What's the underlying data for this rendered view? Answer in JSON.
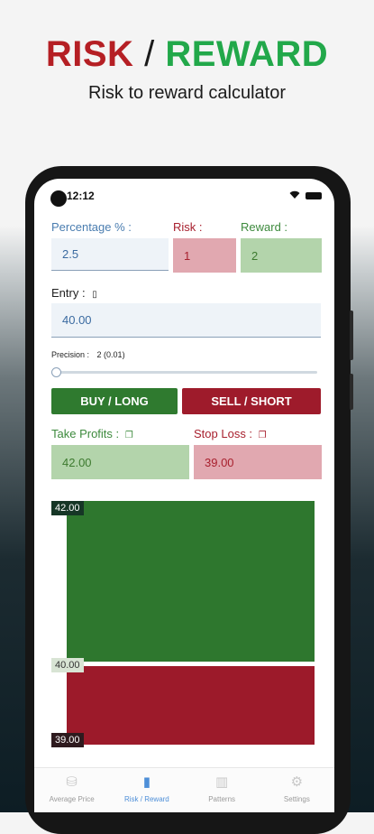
{
  "promo": {
    "title_left": "RISK",
    "title_sep": "/",
    "title_right": "REWARD",
    "subtitle": "Risk to reward calculator"
  },
  "status_bar": {
    "time": "12:12"
  },
  "form": {
    "percentage_label": "Percentage % :",
    "percentage_value": "2.5",
    "risk_label": "Risk :",
    "risk_value": "1",
    "reward_label": "Reward :",
    "reward_value": "2",
    "entry_label": "Entry :",
    "entry_value": "40.00",
    "precision_label": "Precision :",
    "precision_value": "2 (0.01)",
    "precision_slider_level": 0,
    "buy_label": "BUY / LONG",
    "sell_label": "SELL / SHORT",
    "take_profits_label": "Take Profits :",
    "take_profits_value": "42.00",
    "stop_loss_label": "Stop Loss :",
    "stop_loss_value": "39.00"
  },
  "visual": {
    "take_profit_tag": "42.00",
    "entry_tag": "40.00",
    "stop_loss_tag": "39.00"
  },
  "nav": [
    {
      "label": "Average Price",
      "icon": "coins-icon",
      "active": false
    },
    {
      "label": "Risk / Reward",
      "icon": "risk-reward-icon",
      "active": true
    },
    {
      "label": "Patterns",
      "icon": "candles-icon",
      "active": false
    },
    {
      "label": "Settings",
      "icon": "gear-icon",
      "active": false
    }
  ],
  "colors": {
    "risk_red": "#b51f24",
    "reward_green": "#22a84a",
    "profit_zone": "#2e772e",
    "loss_zone": "#9c1a2a",
    "active_tab": "#4e8fd8"
  }
}
